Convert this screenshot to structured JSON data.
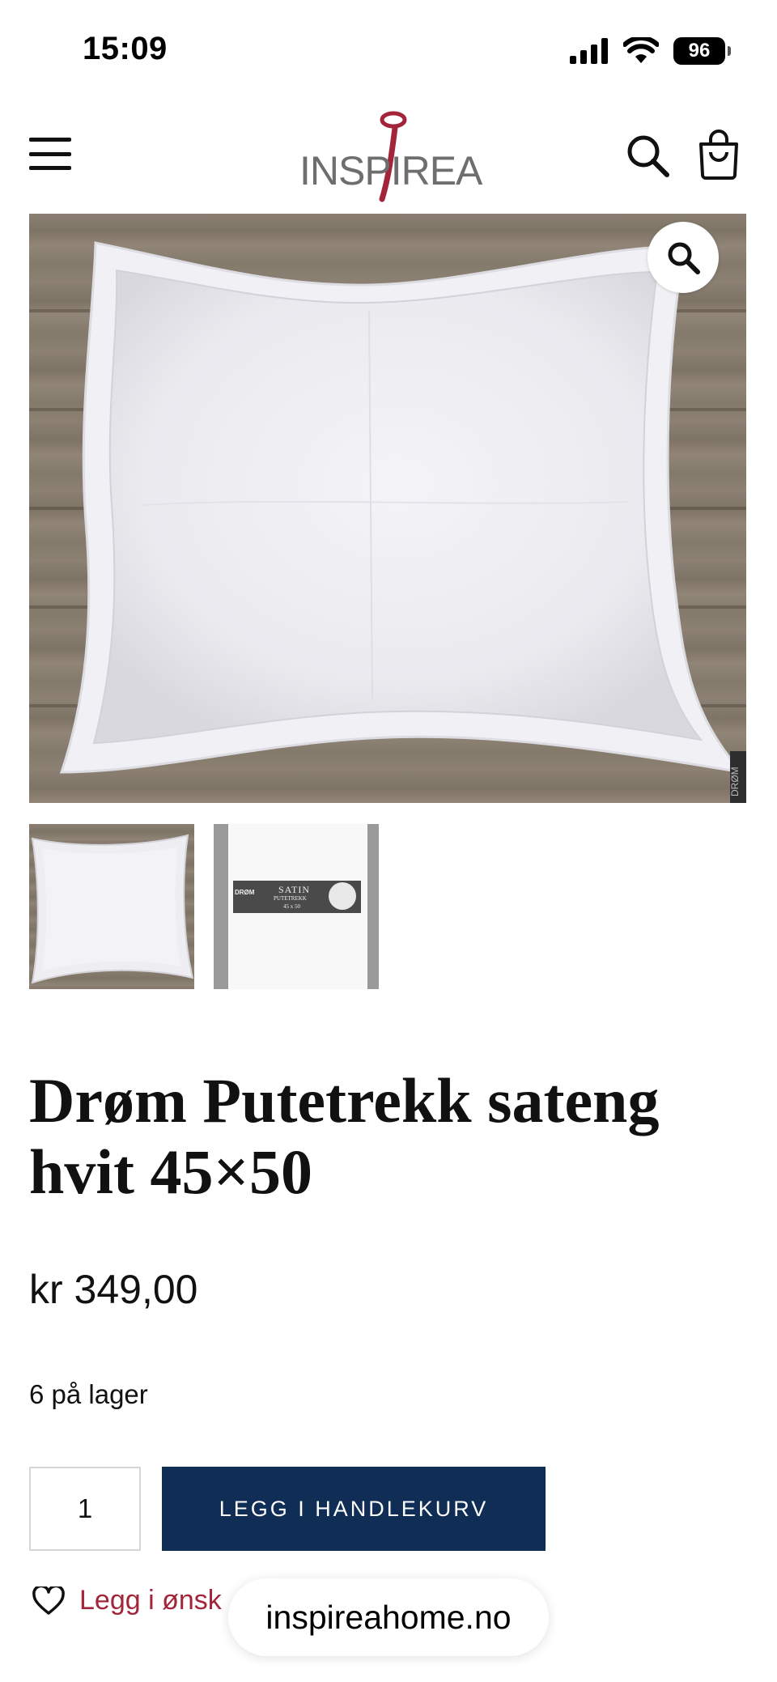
{
  "status_bar": {
    "time": "15:09",
    "battery": "96"
  },
  "header": {
    "logo_text": "INSPIREA"
  },
  "gallery": {
    "thumb2_brand": "DRØM",
    "thumb2_title": "SATIN",
    "thumb2_sub": "PUTETREKK",
    "thumb2_size": "45 x 50",
    "corner_tag": "DRØM"
  },
  "product": {
    "title": "Drøm Putetrekk sateng hvit 45×50",
    "price": "kr 349,00",
    "stock": "6 på lager",
    "quantity": "1",
    "add_to_cart_label": "LEGG I HANDLEKURV",
    "wishlist_label": "Legg i ønsk"
  },
  "browser": {
    "url": "inspireahome.no"
  },
  "colors": {
    "accent": "#a2253a",
    "button": "#0f2d55"
  }
}
